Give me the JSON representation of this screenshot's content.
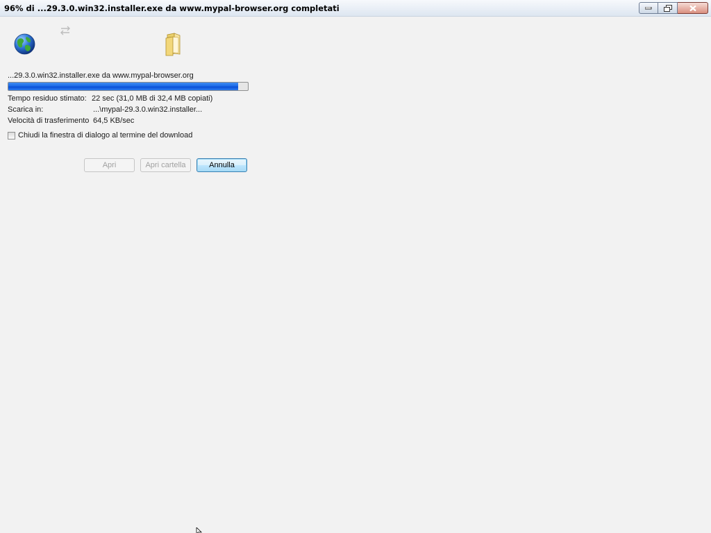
{
  "window": {
    "title": "96% di ...29.3.0.win32.installer.exe da www.mypal-browser.org completati",
    "controls": {
      "minimize": "minimize-icon",
      "maximize": "maximize-icon",
      "close": "close-icon"
    }
  },
  "icons": {
    "source": "globe-icon",
    "transfer": "transfer-arrows-icon",
    "destination": "folder-icon"
  },
  "download": {
    "filename_line": "...29.3.0.win32.installer.exe da www.mypal-browser.org",
    "progress_fraction": 0.96,
    "time_label": "Tempo residuo stimato:",
    "time_value": "22 sec (31,0 MB di 32,4 MB copiati)",
    "dest_label": "Scarica in:",
    "dest_value": "...\\mypal-29.3.0.win32.installer...",
    "speed_label": "Velocità di trasferimento",
    "speed_value": "64,5 KB/sec"
  },
  "options": {
    "close_when_done_label": "Chiudi la finestra di dialogo al termine del download",
    "close_when_done_checked": false
  },
  "buttons": {
    "open": "Apri",
    "open_folder": "Apri cartella",
    "cancel": "Annulla"
  },
  "colors": {
    "progress_fill": "#1d6ce8",
    "background": "#f2f2f2"
  }
}
